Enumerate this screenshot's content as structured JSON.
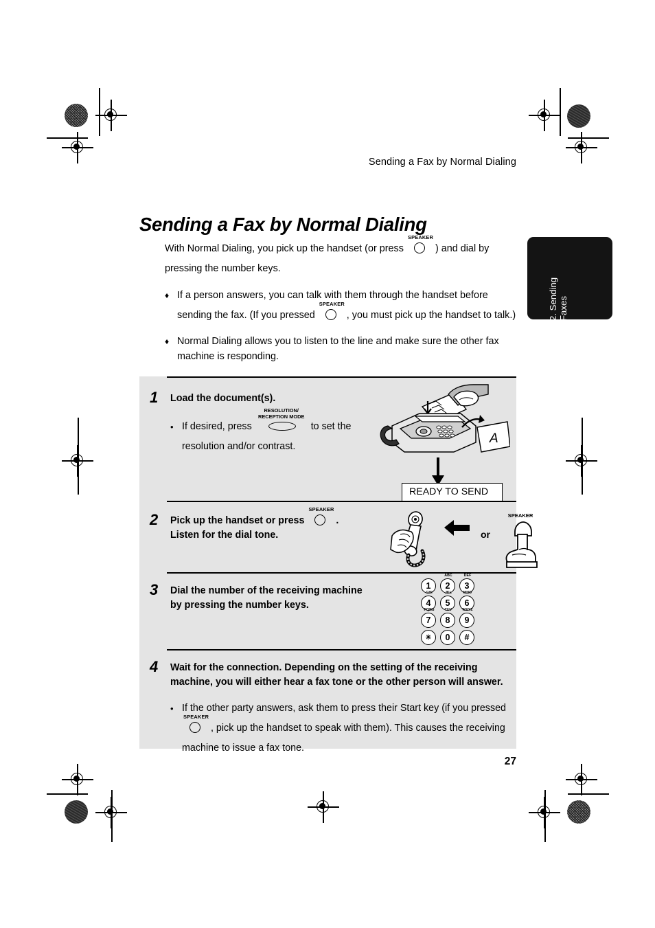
{
  "running_head": "Sending a Fax by Normal Dialing",
  "page_title": "Sending a Fax by Normal Dialing",
  "page_number": "27",
  "side_tab": {
    "label": "2. Sending\nFaxes",
    "background_color": "#141414",
    "text_color": "#ffffff"
  },
  "keys": {
    "speaker_label": "SPEAKER",
    "resolution_label": "RESOLUTION/\nRECEPTION MODE"
  },
  "intro": {
    "paragraph_before_key": "With Normal Dialing, you pick up the handset (or press",
    "paragraph_after_key": ") and dial by pressing the number keys.",
    "bullet_marker": "♦",
    "bullets": [
      {
        "text_before_key": "If a person answers, you can talk with them through the handset before sending the fax. (If you pressed",
        "text_after_key": ", you must pick up the handset to talk.)"
      },
      {
        "text_before_key": "Normal Dialing allows you to listen to the line and make sure the other fax machine is responding.",
        "text_after_key": ""
      }
    ]
  },
  "steps": [
    {
      "number": "1",
      "heading": "Load the document(s).",
      "sub_marker": "•",
      "sub_before_key": "If desired, press",
      "sub_after_key": "to set the resolution and/or contrast.",
      "illustration": "fax-machine-loading-document",
      "lcd_text": "READY TO SEND"
    },
    {
      "number": "2",
      "heading_line1_before_key": "Pick up the handset or press",
      "heading_line1_after_key": ".",
      "heading_line2": "Listen for the dial tone.",
      "illustration": "handset-lifted-or-speaker-button",
      "or_label": "or"
    },
    {
      "number": "3",
      "heading": "Dial the number of the receiving machine by pressing the number keys.",
      "illustration": "numeric-keypad"
    },
    {
      "number": "4",
      "heading": "Wait for the connection. Depending on the setting of the receiving machine, you will either hear a fax tone or the other person will answer.",
      "sub_marker": "•",
      "sub_before_key": "If the other party answers, ask them to press their Start key (if you pressed",
      "sub_after_key": ", pick up the handset to speak with them). This causes the receiving machine to issue a fax tone."
    }
  ],
  "keypad": {
    "rows": [
      [
        {
          "digit": "1",
          "letters": ""
        },
        {
          "digit": "2",
          "letters": "ABC"
        },
        {
          "digit": "3",
          "letters": "DEF"
        }
      ],
      [
        {
          "digit": "4",
          "letters": "GHI"
        },
        {
          "digit": "5",
          "letters": "JKL"
        },
        {
          "digit": "6",
          "letters": "MNO"
        }
      ],
      [
        {
          "digit": "7",
          "letters": "PQRS"
        },
        {
          "digit": "8",
          "letters": "TUV"
        },
        {
          "digit": "9",
          "letters": "WXYZ"
        }
      ],
      [
        {
          "digit": "✳",
          "letters": ""
        },
        {
          "digit": "0",
          "letters": ""
        },
        {
          "digit": "#",
          "letters": ""
        }
      ]
    ]
  },
  "colors": {
    "step_panel_background": "#e4e4e4",
    "page_background": "#ffffff",
    "rule": "#000000"
  }
}
